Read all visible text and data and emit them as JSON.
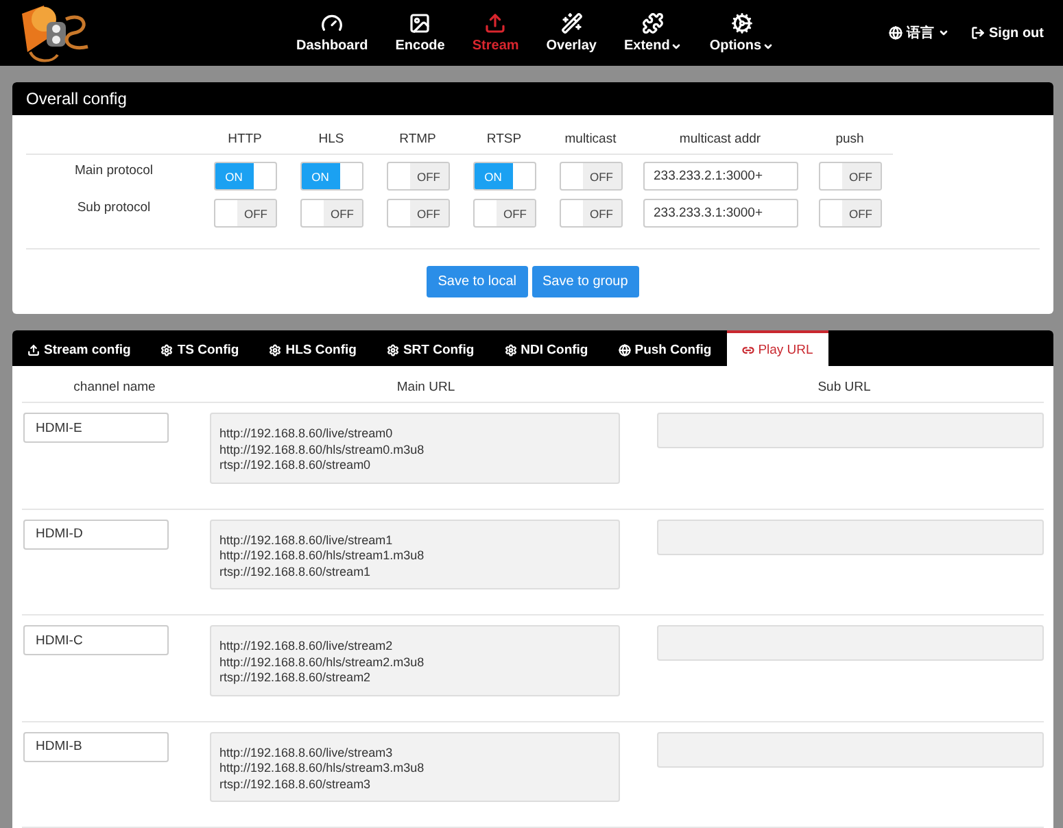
{
  "nav": [
    {
      "label": "Dashboard",
      "selected": false,
      "dropdown": false
    },
    {
      "label": "Encode",
      "selected": false,
      "dropdown": false
    },
    {
      "label": "Stream",
      "selected": true,
      "dropdown": false
    },
    {
      "label": "Overlay",
      "selected": false,
      "dropdown": false
    },
    {
      "label": "Extend",
      "selected": false,
      "dropdown": true
    },
    {
      "label": "Options",
      "selected": false,
      "dropdown": true
    }
  ],
  "language": "语言",
  "sign_out": "Sign out",
  "overall_config": {
    "title": "Overall config",
    "columns": [
      "HTTP",
      "HLS",
      "RTMP",
      "RTSP",
      "multicast",
      "multicast addr",
      "push"
    ],
    "rows": [
      {
        "label": "Main protocol",
        "cells": [
          {
            "kind": "toggle",
            "on": true,
            "text": "ON"
          },
          {
            "kind": "toggle",
            "on": true,
            "text": "ON"
          },
          {
            "kind": "toggle",
            "on": false,
            "text": "OFF"
          },
          {
            "kind": "toggle",
            "on": true,
            "text": "ON"
          },
          {
            "kind": "toggle",
            "on": false,
            "text": "OFF"
          },
          {
            "kind": "field",
            "value": "233.233.2.1:3000+"
          },
          {
            "kind": "toggle",
            "on": false,
            "text": "OFF"
          }
        ]
      },
      {
        "label": "Sub protocol",
        "cells": [
          {
            "kind": "toggle",
            "on": false,
            "text": "OFF"
          },
          {
            "kind": "toggle",
            "on": false,
            "text": "OFF"
          },
          {
            "kind": "toggle",
            "on": false,
            "text": "OFF"
          },
          {
            "kind": "toggle",
            "on": false,
            "text": "OFF"
          },
          {
            "kind": "toggle",
            "on": false,
            "text": "OFF"
          },
          {
            "kind": "field",
            "value": "233.233.3.1:3000+"
          },
          {
            "kind": "toggle",
            "on": false,
            "text": "OFF"
          }
        ]
      }
    ],
    "buttons": [
      "Save to local",
      "Save to group"
    ]
  },
  "tabs": [
    {
      "label": "Stream config",
      "selected": false
    },
    {
      "label": "TS Config",
      "selected": false
    },
    {
      "label": "HLS Config",
      "selected": false
    },
    {
      "label": "SRT Config",
      "selected": false
    },
    {
      "label": "NDI Config",
      "selected": false
    },
    {
      "label": "Push Config",
      "selected": false
    },
    {
      "label": "Play URL",
      "selected": true
    }
  ],
  "play_url": {
    "columns": [
      "channel name",
      "Main URL",
      "Sub URL"
    ],
    "rows": [
      {
        "name": "HDMI-E",
        "main_url": [
          "http://192.168.8.60/live/stream0",
          "http://192.168.8.60/hls/stream0.m3u8",
          "rtsp://192.168.8.60/stream0"
        ]
      },
      {
        "name": "HDMI-D",
        "main_url": [
          "http://192.168.8.60/live/stream1",
          "http://192.168.8.60/hls/stream1.m3u8",
          "rtsp://192.168.8.60/stream1"
        ]
      },
      {
        "name": "HDMI-C",
        "main_url": [
          "http://192.168.8.60/live/stream2",
          "http://192.168.8.60/hls/stream2.m3u8",
          "rtsp://192.168.8.60/stream2"
        ]
      },
      {
        "name": "HDMI-B",
        "main_url": [
          "http://192.168.8.60/live/stream3",
          "http://192.168.8.60/hls/stream3.m3u8",
          "rtsp://192.168.8.60/stream3"
        ]
      }
    ]
  }
}
